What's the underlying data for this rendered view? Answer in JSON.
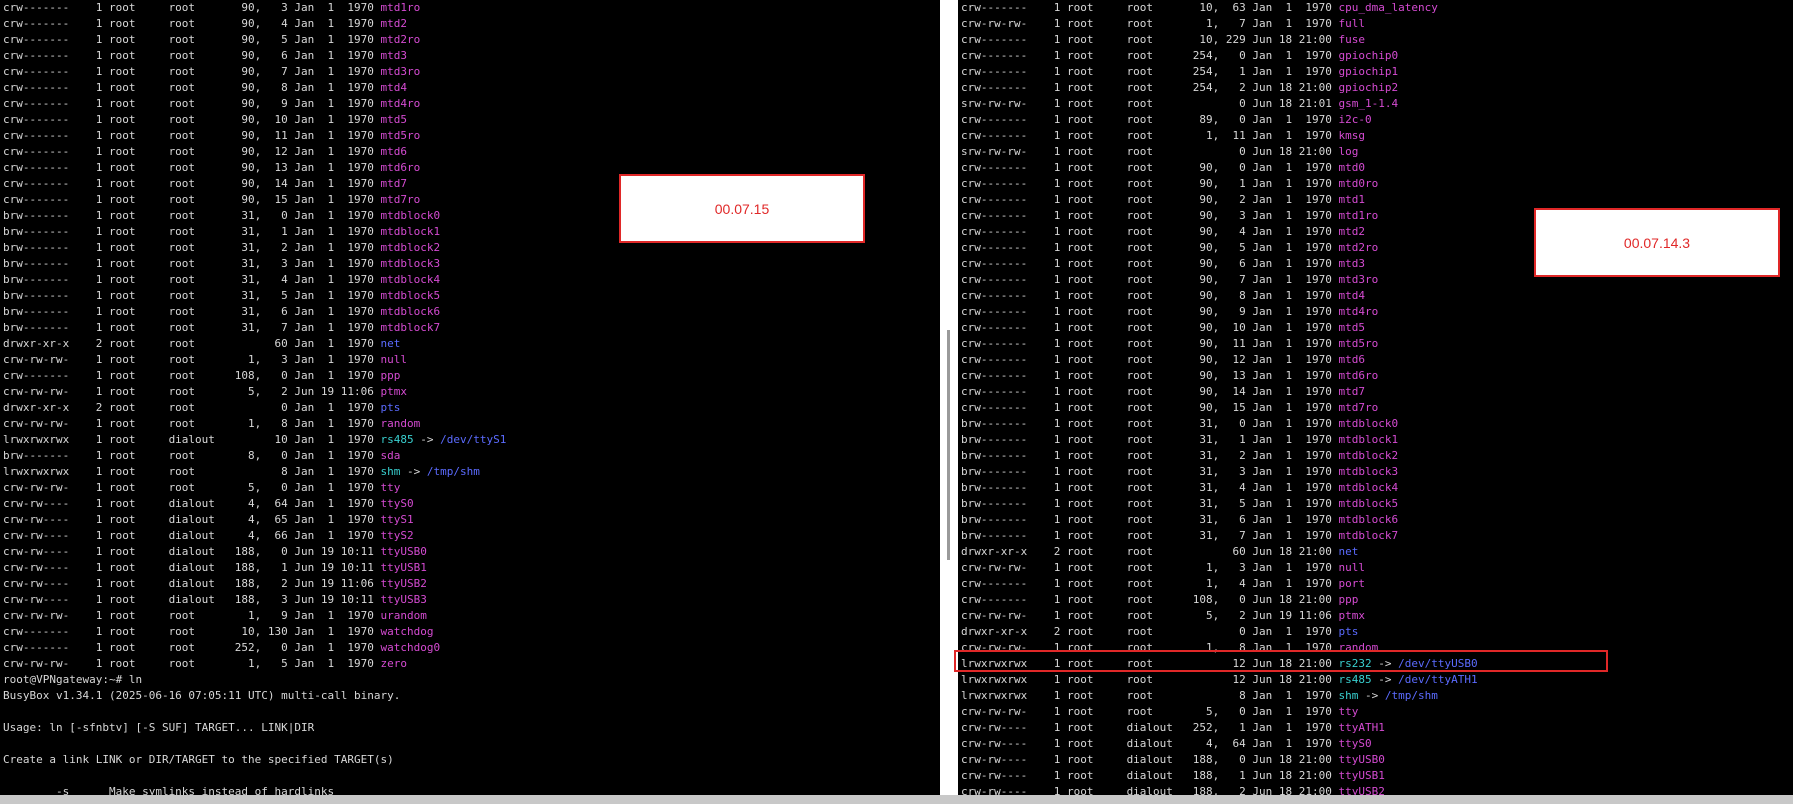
{
  "left_terminal": {
    "lines": [
      {
        "meta": "crw-------    1 root     root       90,   3 Jan  1  1970 ",
        "name": "mtd1ro",
        "color": "mag"
      },
      {
        "meta": "crw-------    1 root     root       90,   4 Jan  1  1970 ",
        "name": "mtd2",
        "color": "mag"
      },
      {
        "meta": "crw-------    1 root     root       90,   5 Jan  1  1970 ",
        "name": "mtd2ro",
        "color": "mag"
      },
      {
        "meta": "crw-------    1 root     root       90,   6 Jan  1  1970 ",
        "name": "mtd3",
        "color": "mag"
      },
      {
        "meta": "crw-------    1 root     root       90,   7 Jan  1  1970 ",
        "name": "mtd3ro",
        "color": "mag"
      },
      {
        "meta": "crw-------    1 root     root       90,   8 Jan  1  1970 ",
        "name": "mtd4",
        "color": "mag"
      },
      {
        "meta": "crw-------    1 root     root       90,   9 Jan  1  1970 ",
        "name": "mtd4ro",
        "color": "mag"
      },
      {
        "meta": "crw-------    1 root     root       90,  10 Jan  1  1970 ",
        "name": "mtd5",
        "color": "mag"
      },
      {
        "meta": "crw-------    1 root     root       90,  11 Jan  1  1970 ",
        "name": "mtd5ro",
        "color": "mag"
      },
      {
        "meta": "crw-------    1 root     root       90,  12 Jan  1  1970 ",
        "name": "mtd6",
        "color": "mag"
      },
      {
        "meta": "crw-------    1 root     root       90,  13 Jan  1  1970 ",
        "name": "mtd6ro",
        "color": "mag"
      },
      {
        "meta": "crw-------    1 root     root       90,  14 Jan  1  1970 ",
        "name": "mtd7",
        "color": "mag"
      },
      {
        "meta": "crw-------    1 root     root       90,  15 Jan  1  1970 ",
        "name": "mtd7ro",
        "color": "mag"
      },
      {
        "meta": "brw-------    1 root     root       31,   0 Jan  1  1970 ",
        "name": "mtdblock0",
        "color": "mag"
      },
      {
        "meta": "brw-------    1 root     root       31,   1 Jan  1  1970 ",
        "name": "mtdblock1",
        "color": "mag"
      },
      {
        "meta": "brw-------    1 root     root       31,   2 Jan  1  1970 ",
        "name": "mtdblock2",
        "color": "mag"
      },
      {
        "meta": "brw-------    1 root     root       31,   3 Jan  1  1970 ",
        "name": "mtdblock3",
        "color": "mag"
      },
      {
        "meta": "brw-------    1 root     root       31,   4 Jan  1  1970 ",
        "name": "mtdblock4",
        "color": "mag"
      },
      {
        "meta": "brw-------    1 root     root       31,   5 Jan  1  1970 ",
        "name": "mtdblock5",
        "color": "mag"
      },
      {
        "meta": "brw-------    1 root     root       31,   6 Jan  1  1970 ",
        "name": "mtdblock6",
        "color": "mag"
      },
      {
        "meta": "brw-------    1 root     root       31,   7 Jan  1  1970 ",
        "name": "mtdblock7",
        "color": "mag"
      },
      {
        "meta": "drwxr-xr-x    2 root     root            60 Jan  1  1970 ",
        "name": "net",
        "color": "blue"
      },
      {
        "meta": "crw-rw-rw-    1 root     root        1,   3 Jan  1  1970 ",
        "name": "null",
        "color": "mag"
      },
      {
        "meta": "crw-------    1 root     root      108,   0 Jan  1  1970 ",
        "name": "ppp",
        "color": "mag"
      },
      {
        "meta": "crw-rw-rw-    1 root     root        5,   2 Jun 19 11:06 ",
        "name": "ptmx",
        "color": "mag"
      },
      {
        "meta": "drwxr-xr-x    2 root     root             0 Jan  1  1970 ",
        "name": "pts",
        "color": "blue"
      },
      {
        "meta": "crw-rw-rw-    1 root     root        1,   8 Jan  1  1970 ",
        "name": "random",
        "color": "mag"
      },
      {
        "meta": "lrwxrwxrwx    1 root     dialout         10 Jan  1  1970 ",
        "name": "rs485",
        "color": "cyan",
        "target": "/dev/ttyS1"
      },
      {
        "meta": "brw-------    1 root     root        8,   0 Jan  1  1970 ",
        "name": "sda",
        "color": "mag"
      },
      {
        "meta": "lrwxrwxrwx    1 root     root             8 Jan  1  1970 ",
        "name": "shm",
        "color": "cyan",
        "target": "/tmp/shm"
      },
      {
        "meta": "crw-rw-rw-    1 root     root        5,   0 Jan  1  1970 ",
        "name": "tty",
        "color": "mag"
      },
      {
        "meta": "crw-rw----    1 root     dialout     4,  64 Jan  1  1970 ",
        "name": "ttyS0",
        "color": "mag"
      },
      {
        "meta": "crw-rw----    1 root     dialout     4,  65 Jan  1  1970 ",
        "name": "ttyS1",
        "color": "mag"
      },
      {
        "meta": "crw-rw----    1 root     dialout     4,  66 Jan  1  1970 ",
        "name": "ttyS2",
        "color": "mag"
      },
      {
        "meta": "crw-rw----    1 root     dialout   188,   0 Jun 19 10:11 ",
        "name": "ttyUSB0",
        "color": "mag"
      },
      {
        "meta": "crw-rw----    1 root     dialout   188,   1 Jun 19 10:11 ",
        "name": "ttyUSB1",
        "color": "mag"
      },
      {
        "meta": "crw-rw----    1 root     dialout   188,   2 Jun 19 11:06 ",
        "name": "ttyUSB2",
        "color": "mag"
      },
      {
        "meta": "crw-rw----    1 root     dialout   188,   3 Jun 19 10:11 ",
        "name": "ttyUSB3",
        "color": "mag"
      },
      {
        "meta": "crw-rw-rw-    1 root     root        1,   9 Jan  1  1970 ",
        "name": "urandom",
        "color": "mag"
      },
      {
        "meta": "crw-------    1 root     root       10, 130 Jan  1  1970 ",
        "name": "watchdog",
        "color": "mag"
      },
      {
        "meta": "crw-------    1 root     root      252,   0 Jan  1  1970 ",
        "name": "watchdog0",
        "color": "mag"
      },
      {
        "meta": "crw-rw-rw-    1 root     root        1,   5 Jan  1  1970 ",
        "name": "zero",
        "color": "mag"
      },
      {
        "meta": "root@VPNgateway:~# ln",
        "name": "",
        "color": "plain"
      },
      {
        "meta": "BusyBox v1.34.1 (2025-06-16 07:05:11 UTC) multi-call binary.",
        "name": "",
        "color": "plain"
      },
      {
        "meta": "",
        "name": "",
        "color": "plain"
      },
      {
        "meta": "Usage: ln [-sfnbtv] [-S SUF] TARGET... LINK|DIR",
        "name": "",
        "color": "plain"
      },
      {
        "meta": "",
        "name": "",
        "color": "plain"
      },
      {
        "meta": "Create a link LINK or DIR/TARGET to the specified TARGET(s)",
        "name": "",
        "color": "plain"
      },
      {
        "meta": "",
        "name": "",
        "color": "plain"
      },
      {
        "meta": "        -s      Make symlinks instead of hardlinks",
        "name": "",
        "color": "plain"
      }
    ]
  },
  "right_terminal": {
    "lines": [
      {
        "meta": "crw-------    1 root     root       10,  63 Jan  1  1970 ",
        "name": "cpu_dma_latency",
        "color": "mag"
      },
      {
        "meta": "crw-rw-rw-    1 root     root        1,   7 Jan  1  1970 ",
        "name": "full",
        "color": "mag"
      },
      {
        "meta": "crw-------    1 root     root       10, 229 Jun 18 21:00 ",
        "name": "fuse",
        "color": "mag"
      },
      {
        "meta": "crw-------    1 root     root      254,   0 Jan  1  1970 ",
        "name": "gpiochip0",
        "color": "mag"
      },
      {
        "meta": "crw-------    1 root     root      254,   1 Jan  1  1970 ",
        "name": "gpiochip1",
        "color": "mag"
      },
      {
        "meta": "crw-------    1 root     root      254,   2 Jun 18 21:00 ",
        "name": "gpiochip2",
        "color": "mag"
      },
      {
        "meta": "srw-rw-rw-    1 root     root             0 Jun 18 21:01 ",
        "name": "gsm_1-1.4",
        "color": "mag"
      },
      {
        "meta": "crw-------    1 root     root       89,   0 Jan  1  1970 ",
        "name": "i2c-0",
        "color": "mag"
      },
      {
        "meta": "crw-------    1 root     root        1,  11 Jan  1  1970 ",
        "name": "kmsg",
        "color": "mag"
      },
      {
        "meta": "srw-rw-rw-    1 root     root             0 Jun 18 21:00 ",
        "name": "log",
        "color": "mag"
      },
      {
        "meta": "crw-------    1 root     root       90,   0 Jan  1  1970 ",
        "name": "mtd0",
        "color": "mag"
      },
      {
        "meta": "crw-------    1 root     root       90,   1 Jan  1  1970 ",
        "name": "mtd0ro",
        "color": "mag"
      },
      {
        "meta": "crw-------    1 root     root       90,   2 Jan  1  1970 ",
        "name": "mtd1",
        "color": "mag"
      },
      {
        "meta": "crw-------    1 root     root       90,   3 Jan  1  1970 ",
        "name": "mtd1ro",
        "color": "mag"
      },
      {
        "meta": "crw-------    1 root     root       90,   4 Jan  1  1970 ",
        "name": "mtd2",
        "color": "mag"
      },
      {
        "meta": "crw-------    1 root     root       90,   5 Jan  1  1970 ",
        "name": "mtd2ro",
        "color": "mag"
      },
      {
        "meta": "crw-------    1 root     root       90,   6 Jan  1  1970 ",
        "name": "mtd3",
        "color": "mag"
      },
      {
        "meta": "crw-------    1 root     root       90,   7 Jan  1  1970 ",
        "name": "mtd3ro",
        "color": "mag"
      },
      {
        "meta": "crw-------    1 root     root       90,   8 Jan  1  1970 ",
        "name": "mtd4",
        "color": "mag"
      },
      {
        "meta": "crw-------    1 root     root       90,   9 Jan  1  1970 ",
        "name": "mtd4ro",
        "color": "mag"
      },
      {
        "meta": "crw-------    1 root     root       90,  10 Jan  1  1970 ",
        "name": "mtd5",
        "color": "mag"
      },
      {
        "meta": "crw-------    1 root     root       90,  11 Jan  1  1970 ",
        "name": "mtd5ro",
        "color": "mag"
      },
      {
        "meta": "crw-------    1 root     root       90,  12 Jan  1  1970 ",
        "name": "mtd6",
        "color": "mag"
      },
      {
        "meta": "crw-------    1 root     root       90,  13 Jan  1  1970 ",
        "name": "mtd6ro",
        "color": "mag"
      },
      {
        "meta": "crw-------    1 root     root       90,  14 Jan  1  1970 ",
        "name": "mtd7",
        "color": "mag"
      },
      {
        "meta": "crw-------    1 root     root       90,  15 Jan  1  1970 ",
        "name": "mtd7ro",
        "color": "mag"
      },
      {
        "meta": "brw-------    1 root     root       31,   0 Jan  1  1970 ",
        "name": "mtdblock0",
        "color": "mag"
      },
      {
        "meta": "brw-------    1 root     root       31,   1 Jan  1  1970 ",
        "name": "mtdblock1",
        "color": "mag"
      },
      {
        "meta": "brw-------    1 root     root       31,   2 Jan  1  1970 ",
        "name": "mtdblock2",
        "color": "mag"
      },
      {
        "meta": "brw-------    1 root     root       31,   3 Jan  1  1970 ",
        "name": "mtdblock3",
        "color": "mag"
      },
      {
        "meta": "brw-------    1 root     root       31,   4 Jan  1  1970 ",
        "name": "mtdblock4",
        "color": "mag"
      },
      {
        "meta": "brw-------    1 root     root       31,   5 Jan  1  1970 ",
        "name": "mtdblock5",
        "color": "mag"
      },
      {
        "meta": "brw-------    1 root     root       31,   6 Jan  1  1970 ",
        "name": "mtdblock6",
        "color": "mag"
      },
      {
        "meta": "brw-------    1 root     root       31,   7 Jan  1  1970 ",
        "name": "mtdblock7",
        "color": "mag"
      },
      {
        "meta": "drwxr-xr-x    2 root     root            60 Jun 18 21:00 ",
        "name": "net",
        "color": "blue"
      },
      {
        "meta": "crw-rw-rw-    1 root     root        1,   3 Jan  1  1970 ",
        "name": "null",
        "color": "mag"
      },
      {
        "meta": "crw-------    1 root     root        1,   4 Jan  1  1970 ",
        "name": "port",
        "color": "mag"
      },
      {
        "meta": "crw-------    1 root     root      108,   0 Jun 18 21:00 ",
        "name": "ppp",
        "color": "mag"
      },
      {
        "meta": "crw-rw-rw-    1 root     root        5,   2 Jun 19 11:06 ",
        "name": "ptmx",
        "color": "mag"
      },
      {
        "meta": "drwxr-xr-x    2 root     root             0 Jan  1  1970 ",
        "name": "pts",
        "color": "blue"
      },
      {
        "meta": "crw-rw-rw-    1 root     root        1,   8 Jan  1  1970 ",
        "name": "random",
        "color": "mag"
      },
      {
        "meta": "lrwxrwxrwx    1 root     root            12 Jun 18 21:00 ",
        "name": "rs232",
        "color": "cyan",
        "target": "/dev/ttyUSB0"
      },
      {
        "meta": "lrwxrwxrwx    1 root     root            12 Jun 18 21:00 ",
        "name": "rs485",
        "color": "cyan",
        "target": "/dev/ttyATH1"
      },
      {
        "meta": "lrwxrwxrwx    1 root     root             8 Jan  1  1970 ",
        "name": "shm",
        "color": "cyan",
        "target": "/tmp/shm"
      },
      {
        "meta": "crw-rw-rw-    1 root     root        5,   0 Jan  1  1970 ",
        "name": "tty",
        "color": "mag"
      },
      {
        "meta": "crw-rw----    1 root     dialout   252,   1 Jan  1  1970 ",
        "name": "ttyATH1",
        "color": "mag"
      },
      {
        "meta": "crw-rw----    1 root     dialout     4,  64 Jan  1  1970 ",
        "name": "ttyS0",
        "color": "mag"
      },
      {
        "meta": "crw-rw----    1 root     dialout   188,   0 Jun 18 21:00 ",
        "name": "ttyUSB0",
        "color": "mag"
      },
      {
        "meta": "crw-rw----    1 root     dialout   188,   1 Jun 18 21:00 ",
        "name": "ttyUSB1",
        "color": "mag"
      },
      {
        "meta": "crw-rw----    1 root     dialout   188,   2 Jun 18 21:00 ",
        "name": "ttyUSB2",
        "color": "mag"
      }
    ]
  },
  "annotations": {
    "left_label": "00.07.15",
    "right_label": "00.07.14.3"
  },
  "colors": {
    "magenta": "#d54bd2",
    "blue": "#5b6bff",
    "cyan": "#39d0d0",
    "annotation_red": "#e02828"
  }
}
